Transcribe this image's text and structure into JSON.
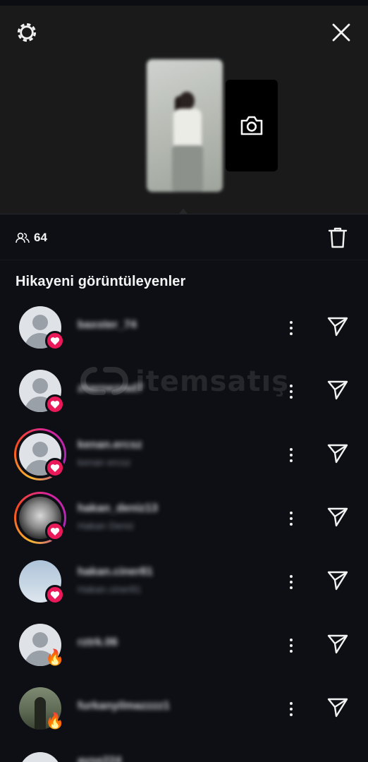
{
  "header": {
    "settings_icon": "gear-icon",
    "close_icon": "close-icon",
    "camera_icon": "camera-icon"
  },
  "stats": {
    "viewers_icon": "people-icon",
    "viewer_count": "64",
    "delete_icon": "trash-icon"
  },
  "section": {
    "title": "Hikayeni görüntüleyenler"
  },
  "watermark": {
    "brand": "itemsatış"
  },
  "viewers": [
    {
      "username": "baxster_74",
      "full_name": "",
      "avatar": "default",
      "ring": false,
      "reaction": "heart"
    },
    {
      "username": "zhernezrad7",
      "full_name": "",
      "avatar": "default",
      "ring": false,
      "reaction": "heart"
    },
    {
      "username": "kenan.ercsz",
      "full_name": "kenan ercsz",
      "avatar": "default",
      "ring": true,
      "reaction": "heart"
    },
    {
      "username": "hakan_deniz13",
      "full_name": "Hakan Deniz",
      "avatar": "muscle-photo",
      "ring": true,
      "reaction": "heart"
    },
    {
      "username": "hakan.ciner81",
      "full_name": "Hakan.ciner81",
      "avatar": "sky-photo",
      "ring": false,
      "reaction": "heart"
    },
    {
      "username": "rztrk.06",
      "full_name": "",
      "avatar": "default",
      "ring": false,
      "reaction": "fire"
    },
    {
      "username": "furkanyilmazzzz1",
      "full_name": "",
      "avatar": "man-photo",
      "ring": false,
      "reaction": "fire"
    },
    {
      "username": "ayse224",
      "full_name": "",
      "avatar": "default",
      "ring": false,
      "reaction": ""
    }
  ],
  "colors": {
    "background": "#0d0f14",
    "story_area": "#1a1a1b",
    "heart_badge": "#e9195a",
    "text": "#f2f3f5"
  }
}
